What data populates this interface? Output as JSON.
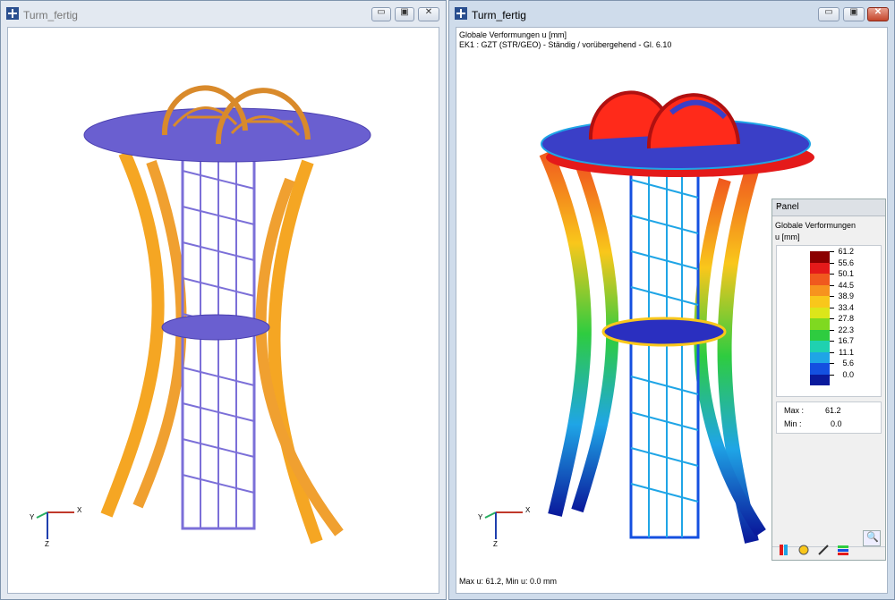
{
  "windows": [
    {
      "title": "Turm_fertig",
      "active": false
    },
    {
      "title": "Turm_fertig",
      "active": true
    }
  ],
  "result_header": {
    "line1": "Globale Verformungen u [mm]",
    "line2": "EK1 : GZT (STR/GEO) - Ständig / vorübergehend - Gl. 6.10"
  },
  "status_line": "Max u: 61.2, Min u: 0.0 mm",
  "axes": {
    "x": "X",
    "y": "Y",
    "z": "Z"
  },
  "panel": {
    "title": "Panel",
    "close": "×",
    "heading": "Globale Verformungen",
    "unit": "u [mm]",
    "legend": [
      {
        "label": "61.2",
        "color": "#8b0000"
      },
      {
        "label": "55.6",
        "color": "#e41a1a"
      },
      {
        "label": "50.1",
        "color": "#f0591e"
      },
      {
        "label": "44.5",
        "color": "#f7931e"
      },
      {
        "label": "38.9",
        "color": "#f9c71b"
      },
      {
        "label": "33.4",
        "color": "#dce61a"
      },
      {
        "label": "27.8",
        "color": "#7fd920"
      },
      {
        "label": "22.3",
        "color": "#2ecc40"
      },
      {
        "label": "16.7",
        "color": "#1fd1b0"
      },
      {
        "label": "11.1",
        "color": "#1fa5e6"
      },
      {
        "label": "5.6",
        "color": "#1450e0"
      },
      {
        "label": "0.0",
        "color": "#0a1a9c"
      }
    ],
    "max_label": "Max :",
    "max_value": "61.2",
    "min_label": "Min :",
    "min_value": "0.0"
  },
  "colors": {
    "member_orange": "#f5a623",
    "bracing_blue": "#7b6fd8",
    "deck_blue": "#5a4fc7"
  }
}
